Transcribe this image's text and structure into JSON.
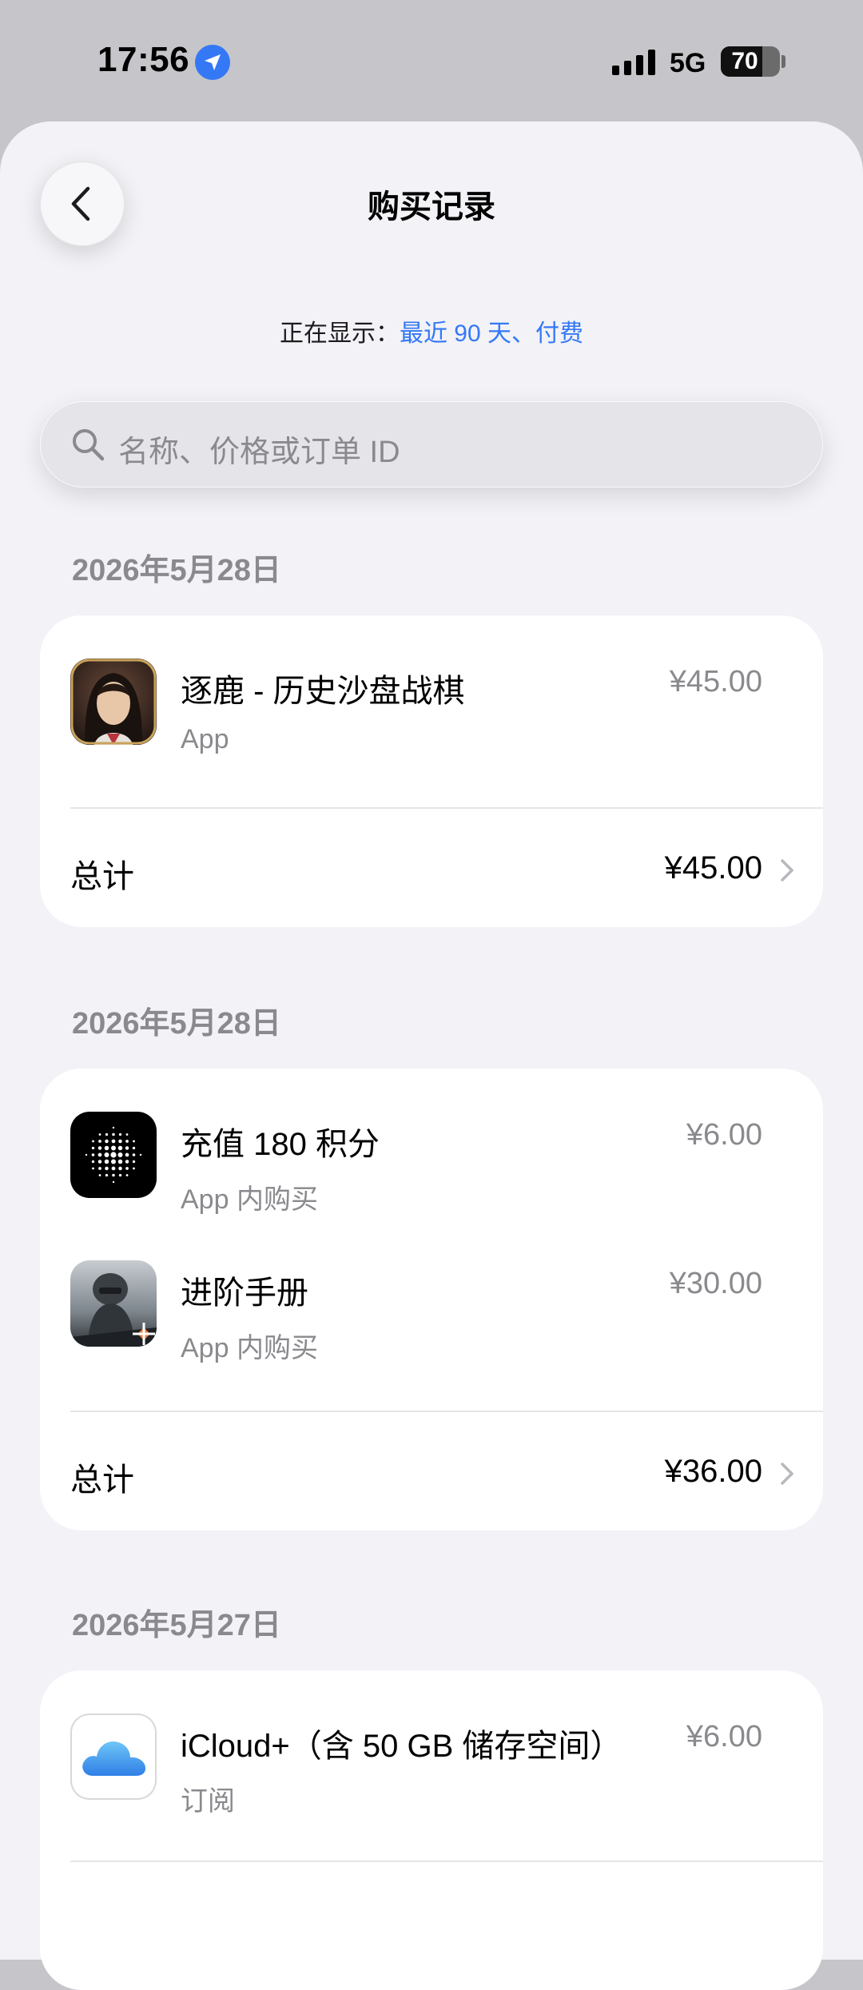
{
  "status": {
    "time": "17:56",
    "network": "5G",
    "battery": "70",
    "battery_level": 0.7
  },
  "header": {
    "title": "购买记录"
  },
  "filter": {
    "label": "正在显示：",
    "value": "最近 90 天、付费"
  },
  "search": {
    "placeholder": "名称、价格或订单 ID"
  },
  "groups": [
    {
      "date": "2026年5月28日",
      "items": [
        {
          "name": "逐鹿 - 历史沙盘战棋",
          "type": "App",
          "price": "¥45.00",
          "icon": "portrait-game-icon"
        }
      ],
      "total_label": "总计",
      "total": "¥45.00"
    },
    {
      "date": "2026年5月28日",
      "items": [
        {
          "name": "充值 180 积分",
          "type": "App 内购买",
          "price": "¥6.00",
          "icon": "dotted-sphere-app-icon"
        },
        {
          "name": "进阶手册",
          "type": "App 内购买",
          "price": "¥30.00",
          "icon": "soldier-game-icon"
        }
      ],
      "total_label": "总计",
      "total": "¥36.00"
    },
    {
      "date": "2026年5月27日",
      "items": [
        {
          "name": "iCloud+（含 50 GB 储存空间）",
          "type": "订阅",
          "price": "¥6.00",
          "icon": "icloud-icon"
        }
      ]
    }
  ]
}
